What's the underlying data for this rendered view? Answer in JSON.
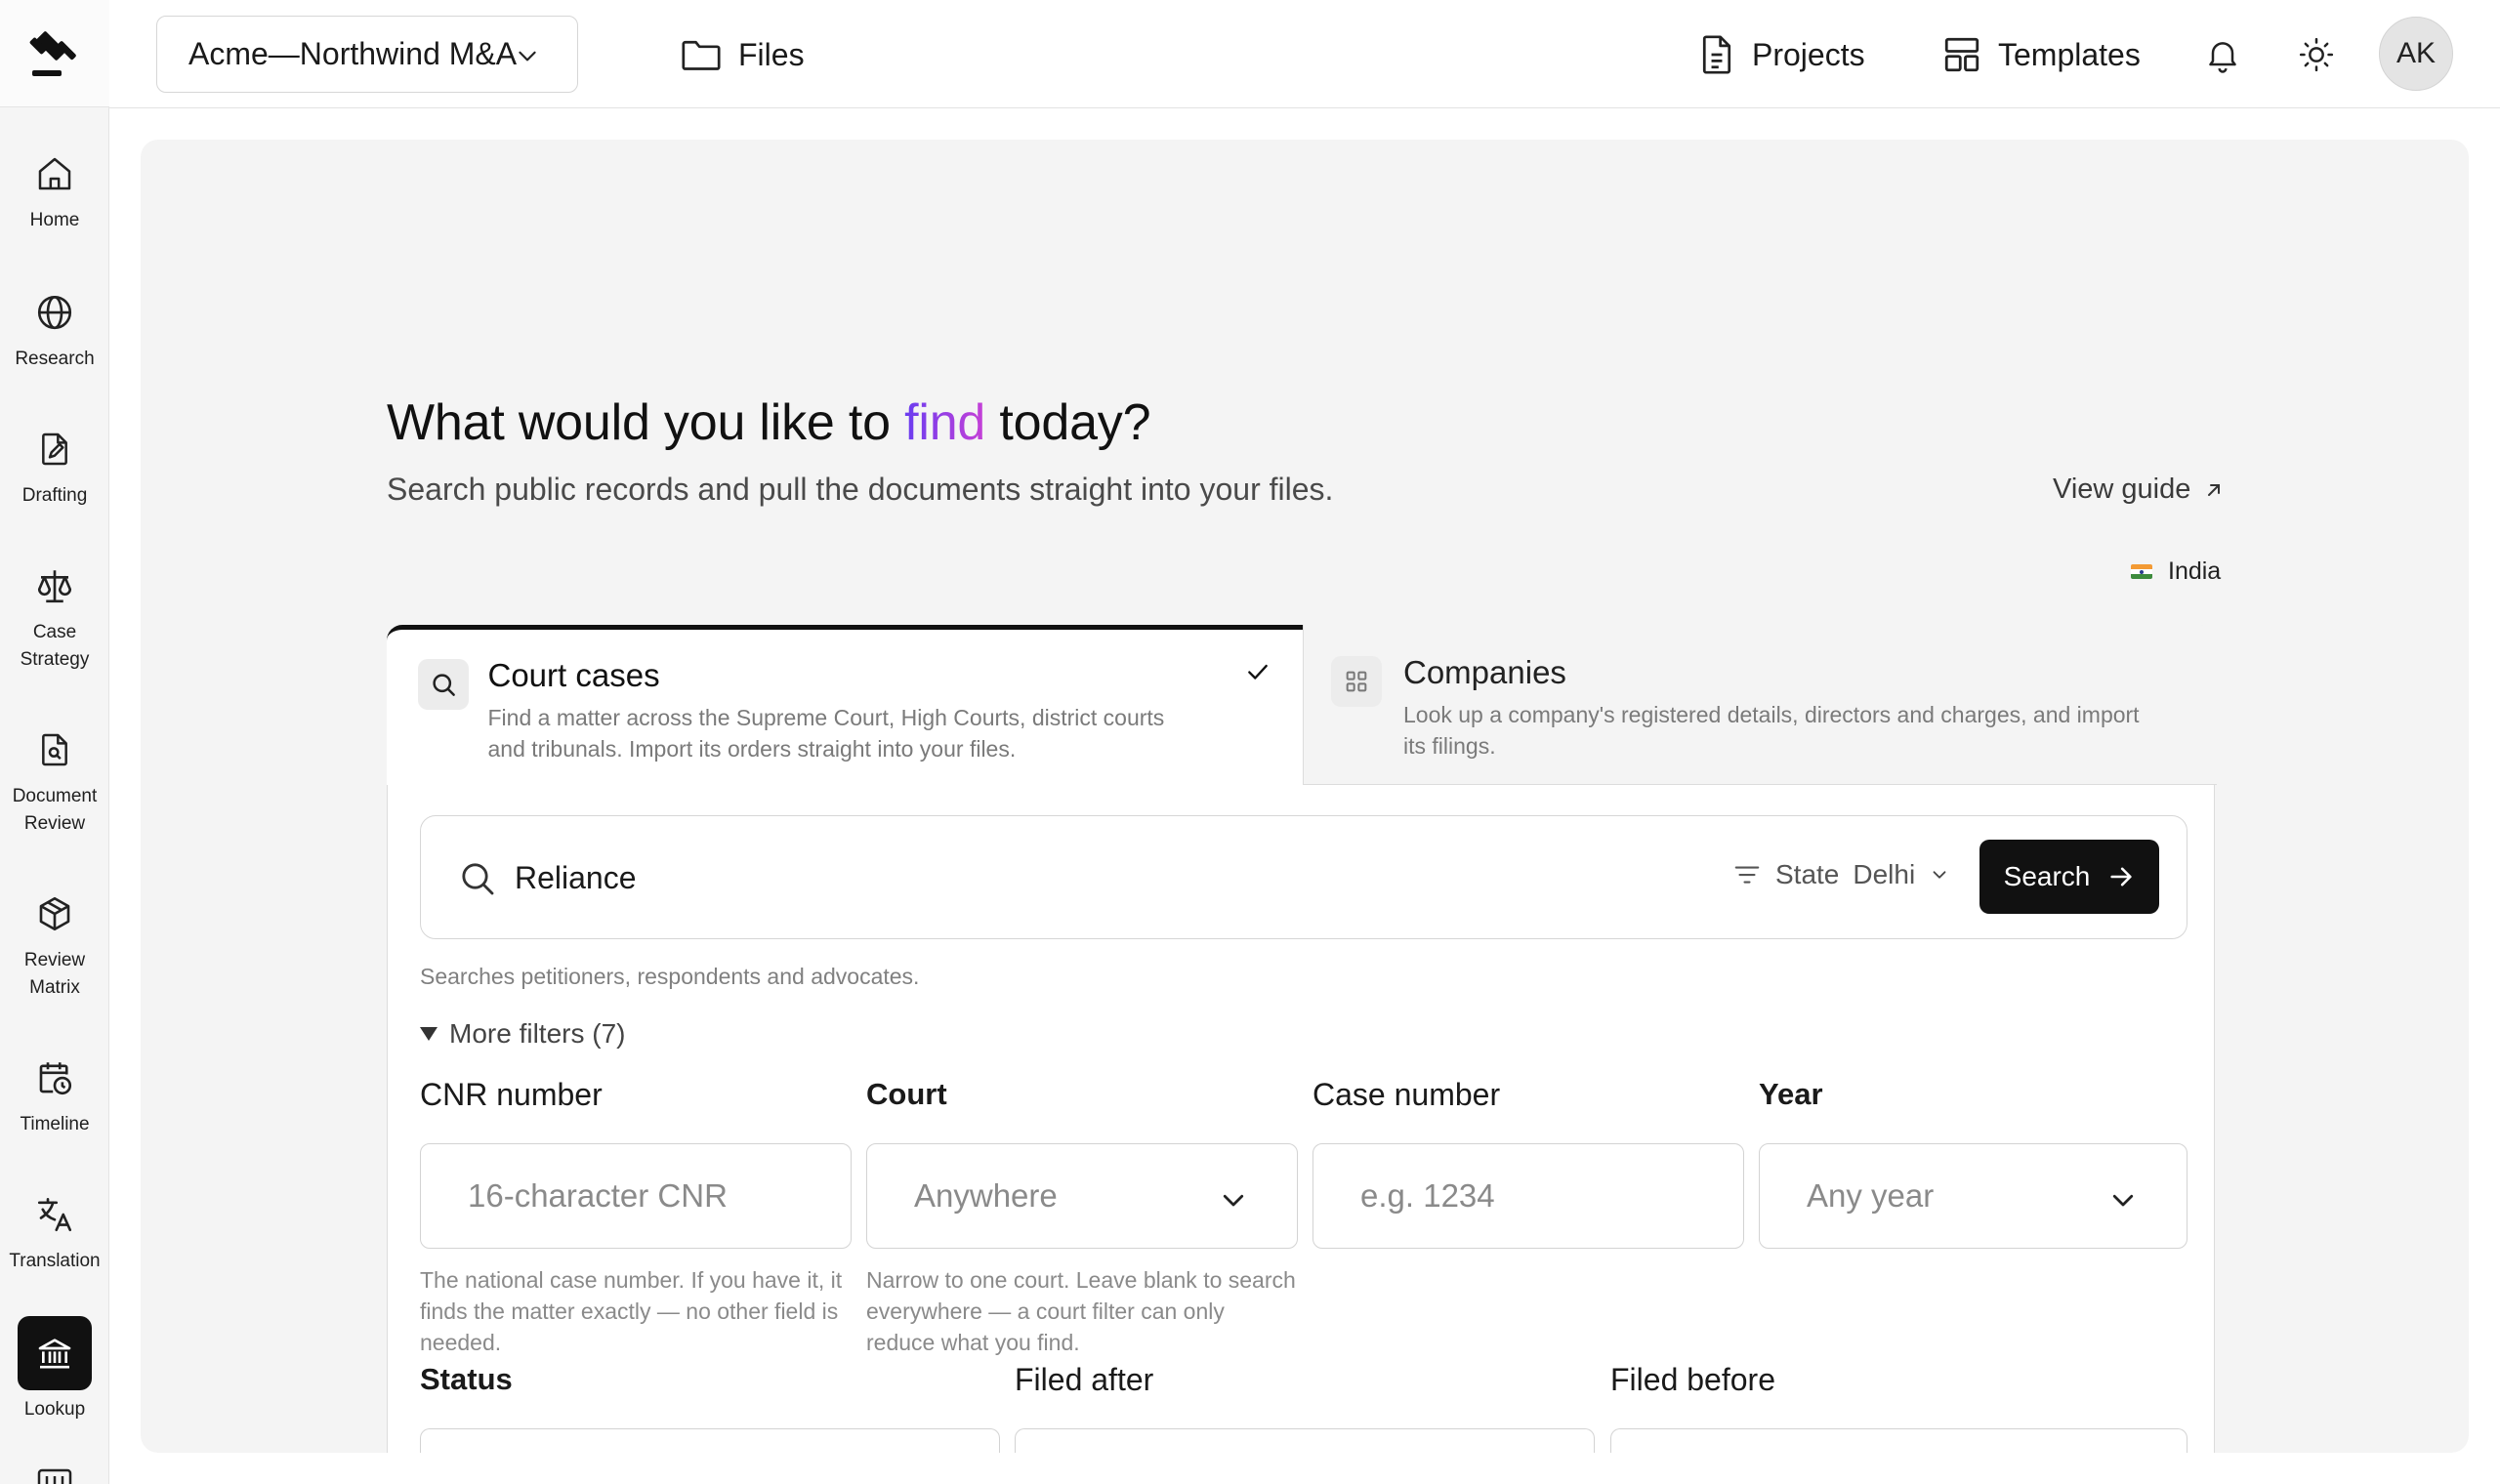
{
  "workspace": {
    "name": "Acme—Northwind M&A"
  },
  "topbar": {
    "files_label": "Files",
    "projects_label": "Projects",
    "templates_label": "Templates",
    "avatar_initials": "AK"
  },
  "sidebar": {
    "items": [
      {
        "label": "Home",
        "icon": "home-icon"
      },
      {
        "label": "Research",
        "icon": "globe-icon"
      },
      {
        "label": "Drafting",
        "icon": "pen-document-icon"
      },
      {
        "label": "Case\nStrategy",
        "icon": "scales-icon"
      },
      {
        "label": "Document\nReview",
        "icon": "document-search-icon"
      },
      {
        "label": "Review\nMatrix",
        "icon": "cube-icon"
      },
      {
        "label": "Timeline",
        "icon": "calendar-clock-icon"
      },
      {
        "label": "Translation",
        "icon": "translate-icon"
      },
      {
        "label": "Lookup",
        "icon": "bank-icon",
        "active": true
      }
    ]
  },
  "hero": {
    "title_before": "What would you like to ",
    "title_highlight": "find",
    "title_after": " today?",
    "subtitle": "Search public records and pull the documents straight into your files.",
    "view_guide": "View guide",
    "country": "India"
  },
  "tabs": {
    "court": {
      "title": "Court cases",
      "description": "Find a matter across the Supreme Court, High Courts, district courts and tribunals. Import its orders straight into your files.",
      "selected": true
    },
    "companies": {
      "title": "Companies",
      "description": "Look up a company's registered details, directors and charges, and import its filings."
    }
  },
  "search": {
    "value": "Reliance",
    "filter_label": "State",
    "filter_value": "Delhi",
    "button_label": "Search",
    "hint": "Searches petitioners, respondents and advocates."
  },
  "more_filters": {
    "label": "More filters (7)"
  },
  "fields": {
    "cnr": {
      "label": "CNR number",
      "placeholder": "16-character CNR",
      "help": "The national case number. If you have it, it finds the matter exactly — no other field is needed."
    },
    "court": {
      "label": "Court",
      "placeholder": "Anywhere",
      "help": "Narrow to one court. Leave blank to search everywhere — a court filter can only reduce what you find."
    },
    "case_number": {
      "label": "Case number",
      "placeholder": "e.g. 1234"
    },
    "year": {
      "label": "Year",
      "placeholder": "Any year"
    },
    "status": {
      "label": "Status"
    },
    "filed_after": {
      "label": "Filed after"
    },
    "filed_before": {
      "label": "Filed before"
    }
  },
  "colors": {
    "accent_start": "#6a3df0",
    "accent_end": "#c640d6",
    "primary": "#111111"
  }
}
